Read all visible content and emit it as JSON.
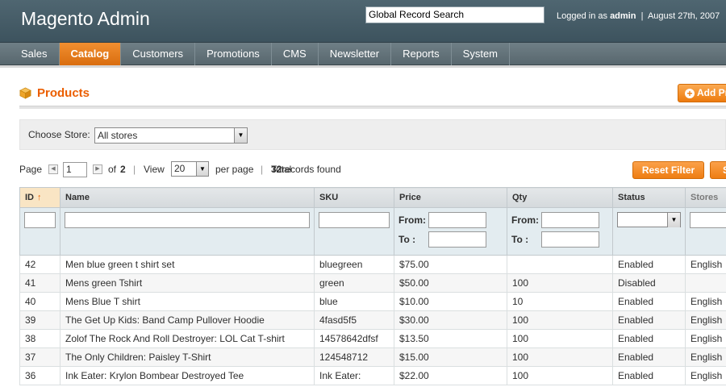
{
  "header": {
    "logo": "Magento Admin",
    "search_value": "Global Record Search",
    "logged_in_prefix": "Logged in as",
    "user": "admin",
    "separator": "|",
    "date": "August 27th, 2007"
  },
  "nav": [
    {
      "label": "Sales",
      "active": false
    },
    {
      "label": "Catalog",
      "active": true
    },
    {
      "label": "Customers",
      "active": false
    },
    {
      "label": "Promotions",
      "active": false
    },
    {
      "label": "CMS",
      "active": false
    },
    {
      "label": "Newsletter",
      "active": false
    },
    {
      "label": "Reports",
      "active": false
    },
    {
      "label": "System",
      "active": false
    }
  ],
  "page": {
    "title": "Products",
    "add_button": "Add Product"
  },
  "store": {
    "label": "Choose Store:",
    "selected": "All stores"
  },
  "pager": {
    "page_label": "Page",
    "page_value": "1",
    "of_label": "of",
    "total_pages": "2",
    "view_label": "View",
    "view_value": "20",
    "per_page_label": "per page",
    "total_prefix": "Total",
    "total_count": "32",
    "total_suffix": "records found"
  },
  "buttons": {
    "reset_filter": "Reset Filter",
    "search": "Search"
  },
  "grid": {
    "columns": [
      "ID",
      "Name",
      "SKU",
      "Price",
      "Qty",
      "Status",
      "Stores"
    ],
    "filter_from": "From:",
    "filter_to": "To :",
    "rows": [
      {
        "id": "42",
        "name": "Men blue green t shirt set",
        "sku": "bluegreen",
        "price": "$75.00",
        "qty": "",
        "status": "Enabled",
        "stores": "English"
      },
      {
        "id": "41",
        "name": "Mens green Tshirt",
        "sku": "green",
        "price": "$50.00",
        "qty": "100",
        "status": "Disabled",
        "stores": ""
      },
      {
        "id": "40",
        "name": "Mens Blue T shirt",
        "sku": "blue",
        "price": "$10.00",
        "qty": "10",
        "status": "Enabled",
        "stores": "English"
      },
      {
        "id": "39",
        "name": "The Get Up Kids: Band Camp Pullover Hoodie",
        "sku": "4fasd5f5",
        "price": "$30.00",
        "qty": "100",
        "status": "Enabled",
        "stores": "English"
      },
      {
        "id": "38",
        "name": "Zolof The Rock And Roll Destroyer: LOL Cat T-shirt",
        "sku": "14578642dfsf",
        "price": "$13.50",
        "qty": "100",
        "status": "Enabled",
        "stores": "English"
      },
      {
        "id": "37",
        "name": "The Only Children: Paisley T-Shirt",
        "sku": "124548712",
        "price": "$15.00",
        "qty": "100",
        "status": "Enabled",
        "stores": "English"
      },
      {
        "id": "36",
        "name": "Ink Eater: Krylon Bombear Destroyed Tee",
        "sku": "Ink Eater:",
        "price": "$22.00",
        "qty": "100",
        "status": "Enabled",
        "stores": "English"
      }
    ]
  },
  "colors": {
    "accent": "#eb5e00",
    "header": "#425862",
    "nav_active": "#e47a19"
  }
}
